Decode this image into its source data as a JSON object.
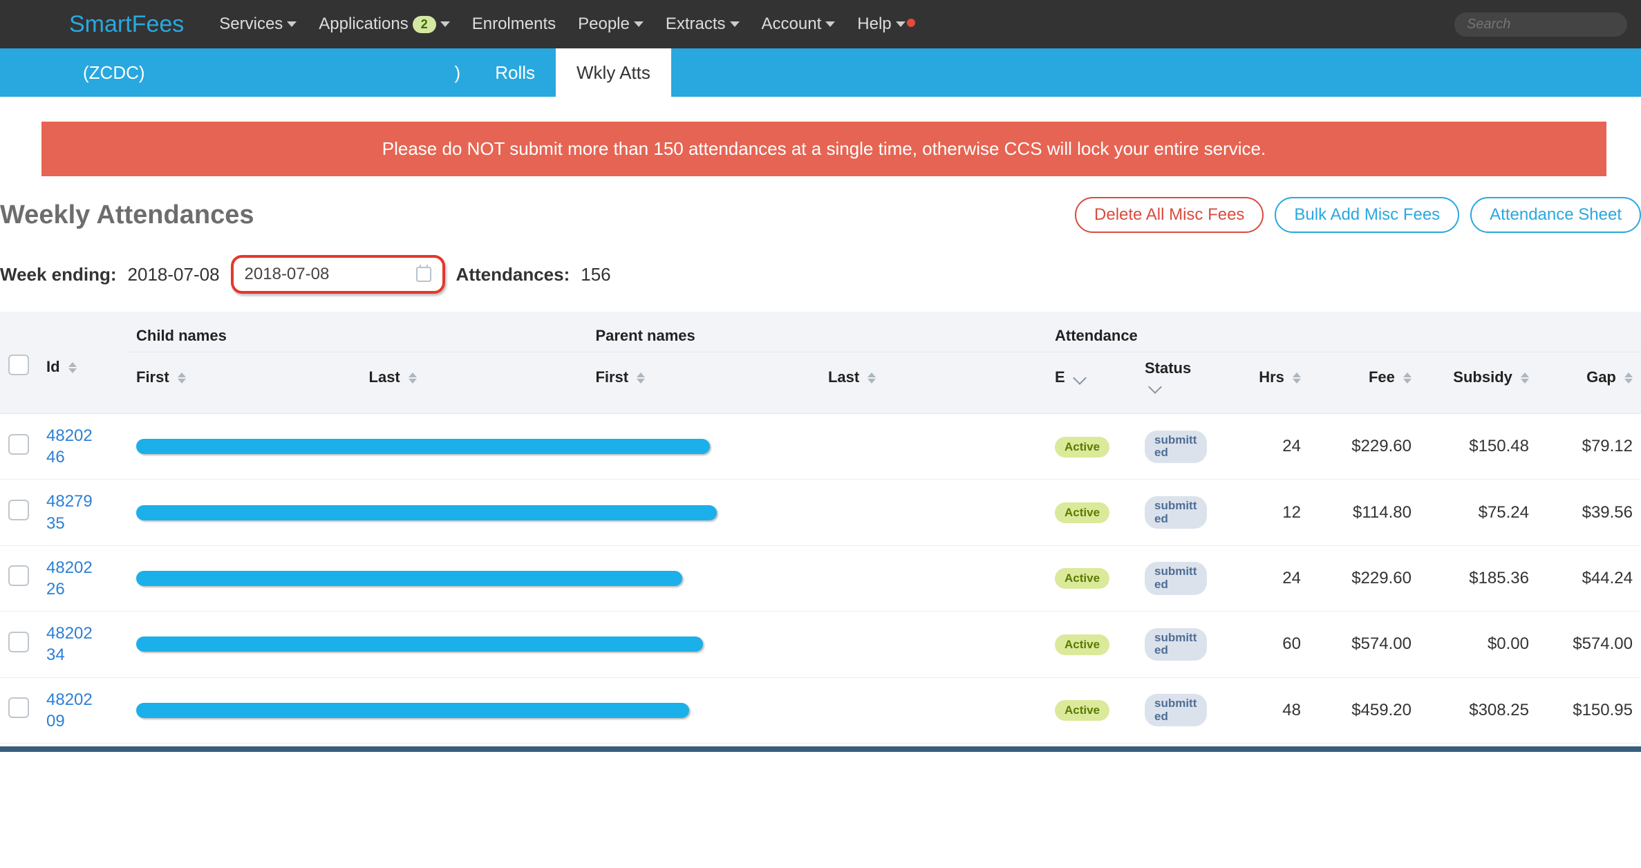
{
  "brand": "SmartFees",
  "nav": {
    "services": "Services",
    "applications": "Applications",
    "apps_badge": "2",
    "enrolments": "Enrolments",
    "people": "People",
    "extracts": "Extracts",
    "account": "Account",
    "help": "Help"
  },
  "search_placeholder": "Search",
  "service_code": "(ZCDC)",
  "service_paren_close": ")",
  "subnav": {
    "rolls": "Rolls",
    "wkly": "Wkly Atts"
  },
  "alert": "Please do NOT submit more than 150 attendances at a single time, otherwise CCS will lock your entire service.",
  "page_title": "Weekly Attendances",
  "buttons": {
    "delete_misc": "Delete All Misc Fees",
    "bulk_add": "Bulk Add Misc Fees",
    "att_sheet": "Attendance Sheet"
  },
  "week": {
    "label": "Week ending:",
    "display_date": "2018-07-08",
    "picker_value": "2018-07-08",
    "att_label": "Attendances:",
    "att_count": "156"
  },
  "columns": {
    "id": "Id",
    "child_group": "Child names",
    "parent_group": "Parent names",
    "att_group": "Attendance",
    "first": "First",
    "last": "Last",
    "e": "E",
    "status": "Status",
    "hrs": "Hrs",
    "fee": "Fee",
    "subsidy": "Subsidy",
    "gap": "Gap"
  },
  "rows": [
    {
      "id1": "48202",
      "id2": "46",
      "e": "Active",
      "status": "submitted",
      "hrs": "24",
      "fee": "$229.60",
      "subsidy": "$150.48",
      "gap": "$79.12",
      "bar_w": "830"
    },
    {
      "id1": "48279",
      "id2": "35",
      "e": "Active",
      "status": "submitted",
      "hrs": "12",
      "fee": "$114.80",
      "subsidy": "$75.24",
      "gap": "$39.56",
      "bar_w": "840"
    },
    {
      "id1": "48202",
      "id2": "26",
      "e": "Active",
      "status": "submitted",
      "hrs": "24",
      "fee": "$229.60",
      "subsidy": "$185.36",
      "gap": "$44.24",
      "bar_w": "790"
    },
    {
      "id1": "48202",
      "id2": "34",
      "e": "Active",
      "status": "submitted",
      "hrs": "60",
      "fee": "$574.00",
      "subsidy": "$0.00",
      "gap": "$574.00",
      "bar_w": "820"
    },
    {
      "id1": "48202",
      "id2": "09",
      "e": "Active",
      "status": "submitted",
      "hrs": "48",
      "fee": "$459.20",
      "subsidy": "$308.25",
      "gap": "$150.95",
      "bar_w": "800"
    }
  ]
}
